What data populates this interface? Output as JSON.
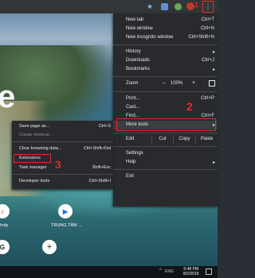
{
  "toolbar": {
    "star_icon": "star-icon",
    "kebab_icon": "more-vert-icon",
    "kebab_glyph": "⋮",
    "step_1": "1"
  },
  "page": {
    "google_letter": "e",
    "shortcuts": [
      {
        "glyph": "♪",
        "label": "Indy"
      },
      {
        "glyph": "▶",
        "label": "TRUNG TÂM ..."
      },
      {
        "glyph": "G",
        "label": ""
      },
      {
        "glyph": "+",
        "label": ""
      }
    ]
  },
  "main_menu": {
    "new_tab": {
      "label": "New tab",
      "shortcut": "Ctrl+T"
    },
    "new_window": {
      "label": "New window",
      "shortcut": "Ctrl+N"
    },
    "new_incognito": {
      "label": "New incognito window",
      "shortcut": "Ctrl+Shift+N"
    },
    "history": {
      "label": "History",
      "arrow": "▸"
    },
    "downloads": {
      "label": "Downloads",
      "shortcut": "Ctrl+J"
    },
    "bookmarks": {
      "label": "Bookmarks",
      "arrow": "▸"
    },
    "zoom": {
      "label": "Zoom",
      "minus": "−",
      "level": "100%",
      "plus": "+"
    },
    "print": {
      "label": "Print...",
      "shortcut": "Ctrl+P"
    },
    "cast": {
      "label": "Cast..."
    },
    "find": {
      "label": "Find...",
      "shortcut": "Ctrl+F"
    },
    "more_tools": {
      "label": "More tools",
      "arrow": "▸"
    },
    "edit": {
      "label": "Edit",
      "cut": "Cut",
      "copy": "Copy",
      "paste": "Paste"
    },
    "settings": {
      "label": "Settings"
    },
    "help": {
      "label": "Help",
      "arrow": "▸"
    },
    "exit": {
      "label": "Exit"
    },
    "step_2": "2"
  },
  "sub_menu": {
    "save_page": {
      "label": "Save page as...",
      "shortcut": "Ctrl+S"
    },
    "create_shortcut": {
      "label": "Create shortcut..."
    },
    "clear_browsing": {
      "label": "Clear browsing data...",
      "shortcut": "Ctrl+Shift+Del"
    },
    "extensions": {
      "label": "Extensions"
    },
    "task_manager": {
      "label": "Task manager",
      "shortcut": "Shift+Esc"
    },
    "developer_tools": {
      "label": "Developer tools",
      "shortcut": "Ctrl+Shift+I"
    },
    "step_3": "3"
  },
  "taskbar": {
    "arrow": "^",
    "language": "ENG",
    "time": "6:48 PM",
    "date": "8/2/2019"
  },
  "colors": {
    "annotation_red": "#e32b2b",
    "menu_bg": "#292a2d",
    "highlight_bg": "#3c3d40"
  }
}
